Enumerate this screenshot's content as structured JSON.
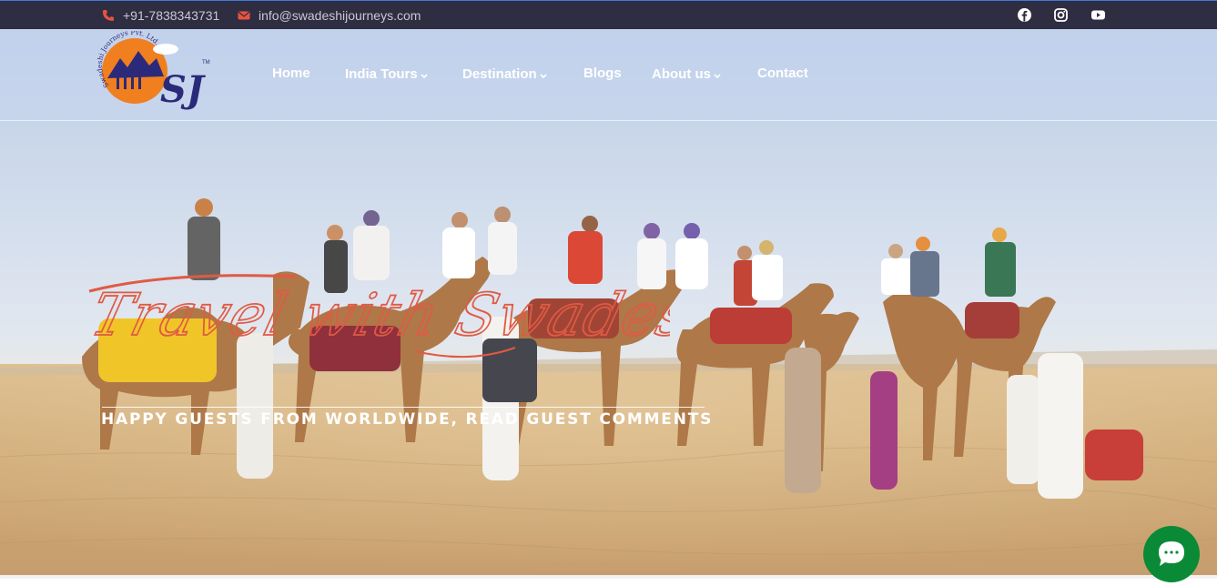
{
  "topbar": {
    "phone": "+91-7838343731",
    "email": "info@swadeshijourneys.com",
    "socials": [
      "facebook-icon",
      "instagram-icon",
      "youtube-icon"
    ]
  },
  "brand": {
    "logo_text": "Swadeshi Journeys Pvt. Ltd.",
    "logo_mark": "SJ",
    "logo_tm": "TM"
  },
  "nav": {
    "items": [
      {
        "label": "Home",
        "dropdown": false
      },
      {
        "label": "India Tours",
        "dropdown": true
      },
      {
        "label": "Destination",
        "dropdown": true
      },
      {
        "label": "Blogs",
        "dropdown": false
      },
      {
        "label": "About us",
        "dropdown": true
      },
      {
        "label": "Contact",
        "dropdown": false
      }
    ]
  },
  "hero": {
    "script_title": "Travel with Swadeshi",
    "tagline": "HAPPY GUESTS FROM WORLDWIDE, READ GUEST COMMENTS"
  },
  "colors": {
    "topbar_bg": "#2f2d42",
    "accent_red": "#e8533f",
    "script_color": "#e05a44",
    "nav_text": "#ffffff",
    "chat_green": "#0a8a36",
    "logo_orange": "#f07f1f",
    "logo_navy": "#2b2a7a"
  }
}
